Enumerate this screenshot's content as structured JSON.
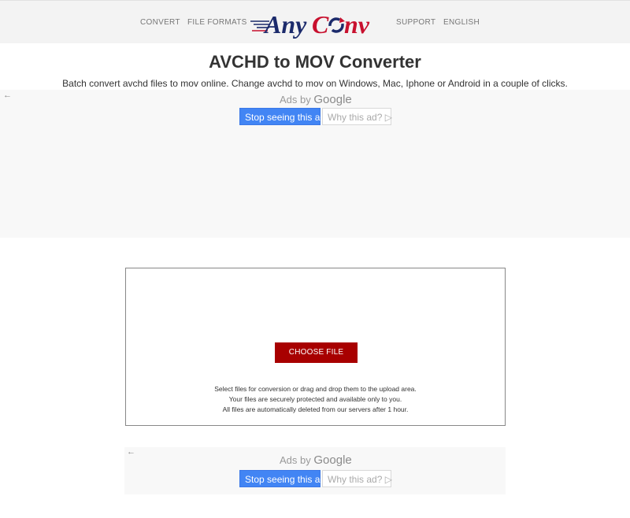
{
  "header": {
    "nav": [
      "CONVERT",
      "FILE FORMATS",
      "SUPPORT",
      "ENGLISH"
    ],
    "logo": {
      "part1": "Any",
      "part2": "C",
      "part3": "nv",
      "colors": {
        "navy": "#1b2a6b",
        "red": "#c8102e"
      }
    }
  },
  "main": {
    "title": "AVCHD to MOV Converter",
    "subtitle": "Batch convert avchd files to mov online. Change avchd to mov on Windows, Mac, Iphone or Android in a couple of clicks."
  },
  "ads": {
    "back_arrow": "←",
    "ads_by": "Ads by",
    "google": "Google",
    "stop_label": "Stop seeing this ad",
    "why_label": "Why this ad?",
    "why_icon": "▷"
  },
  "upload": {
    "button_label": "CHOOSE FILE",
    "note_lines": [
      "Select files for conversion or drag and drop them to the upload area.",
      "Your files are securely protected and available only to you.",
      "All files are automatically deleted from our servers after 1 hour."
    ]
  },
  "colors": {
    "choose_button": "#a80000",
    "ad_button": "#4285f4",
    "topbar": "#f3f3f3"
  }
}
